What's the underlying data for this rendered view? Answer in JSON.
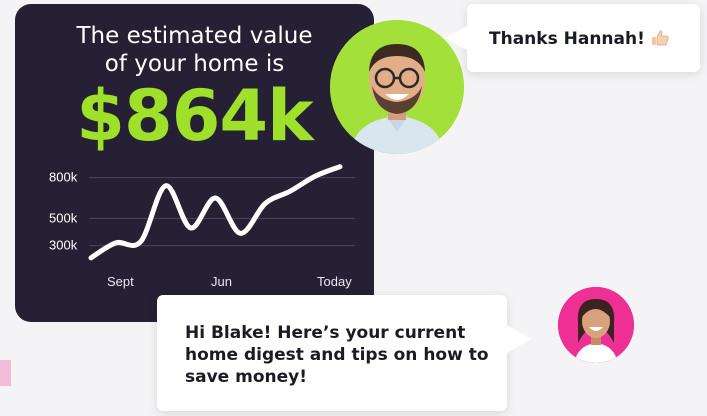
{
  "card": {
    "headline_line1": "The estimated value",
    "headline_line2": "of your home is",
    "value": "$864k",
    "accent_color": "#9ee02a",
    "background_color": "#252034"
  },
  "chart_data": {
    "type": "line",
    "y_ticks": [
      "800k",
      "500k",
      "300k"
    ],
    "x_labels": [
      "Sept",
      "Jun",
      "Today"
    ],
    "x": [
      0,
      1,
      2,
      3,
      4,
      5,
      6,
      7,
      8,
      9,
      10
    ],
    "values": [
      210,
      320,
      330,
      740,
      430,
      650,
      390,
      610,
      700,
      810,
      880
    ],
    "ylim": [
      150,
      900
    ],
    "grid": true,
    "line_color": "#ffffff"
  },
  "chat": {
    "blake_message": "Thanks Hannah!",
    "blake_icon": "thumbs-up-icon",
    "hannah_message": "Hi Blake! Here’s your current home digest and tips on how to save money!"
  },
  "avatars": {
    "blake_bg": "#a4e03a",
    "hannah_bg": "#ee2f93"
  }
}
